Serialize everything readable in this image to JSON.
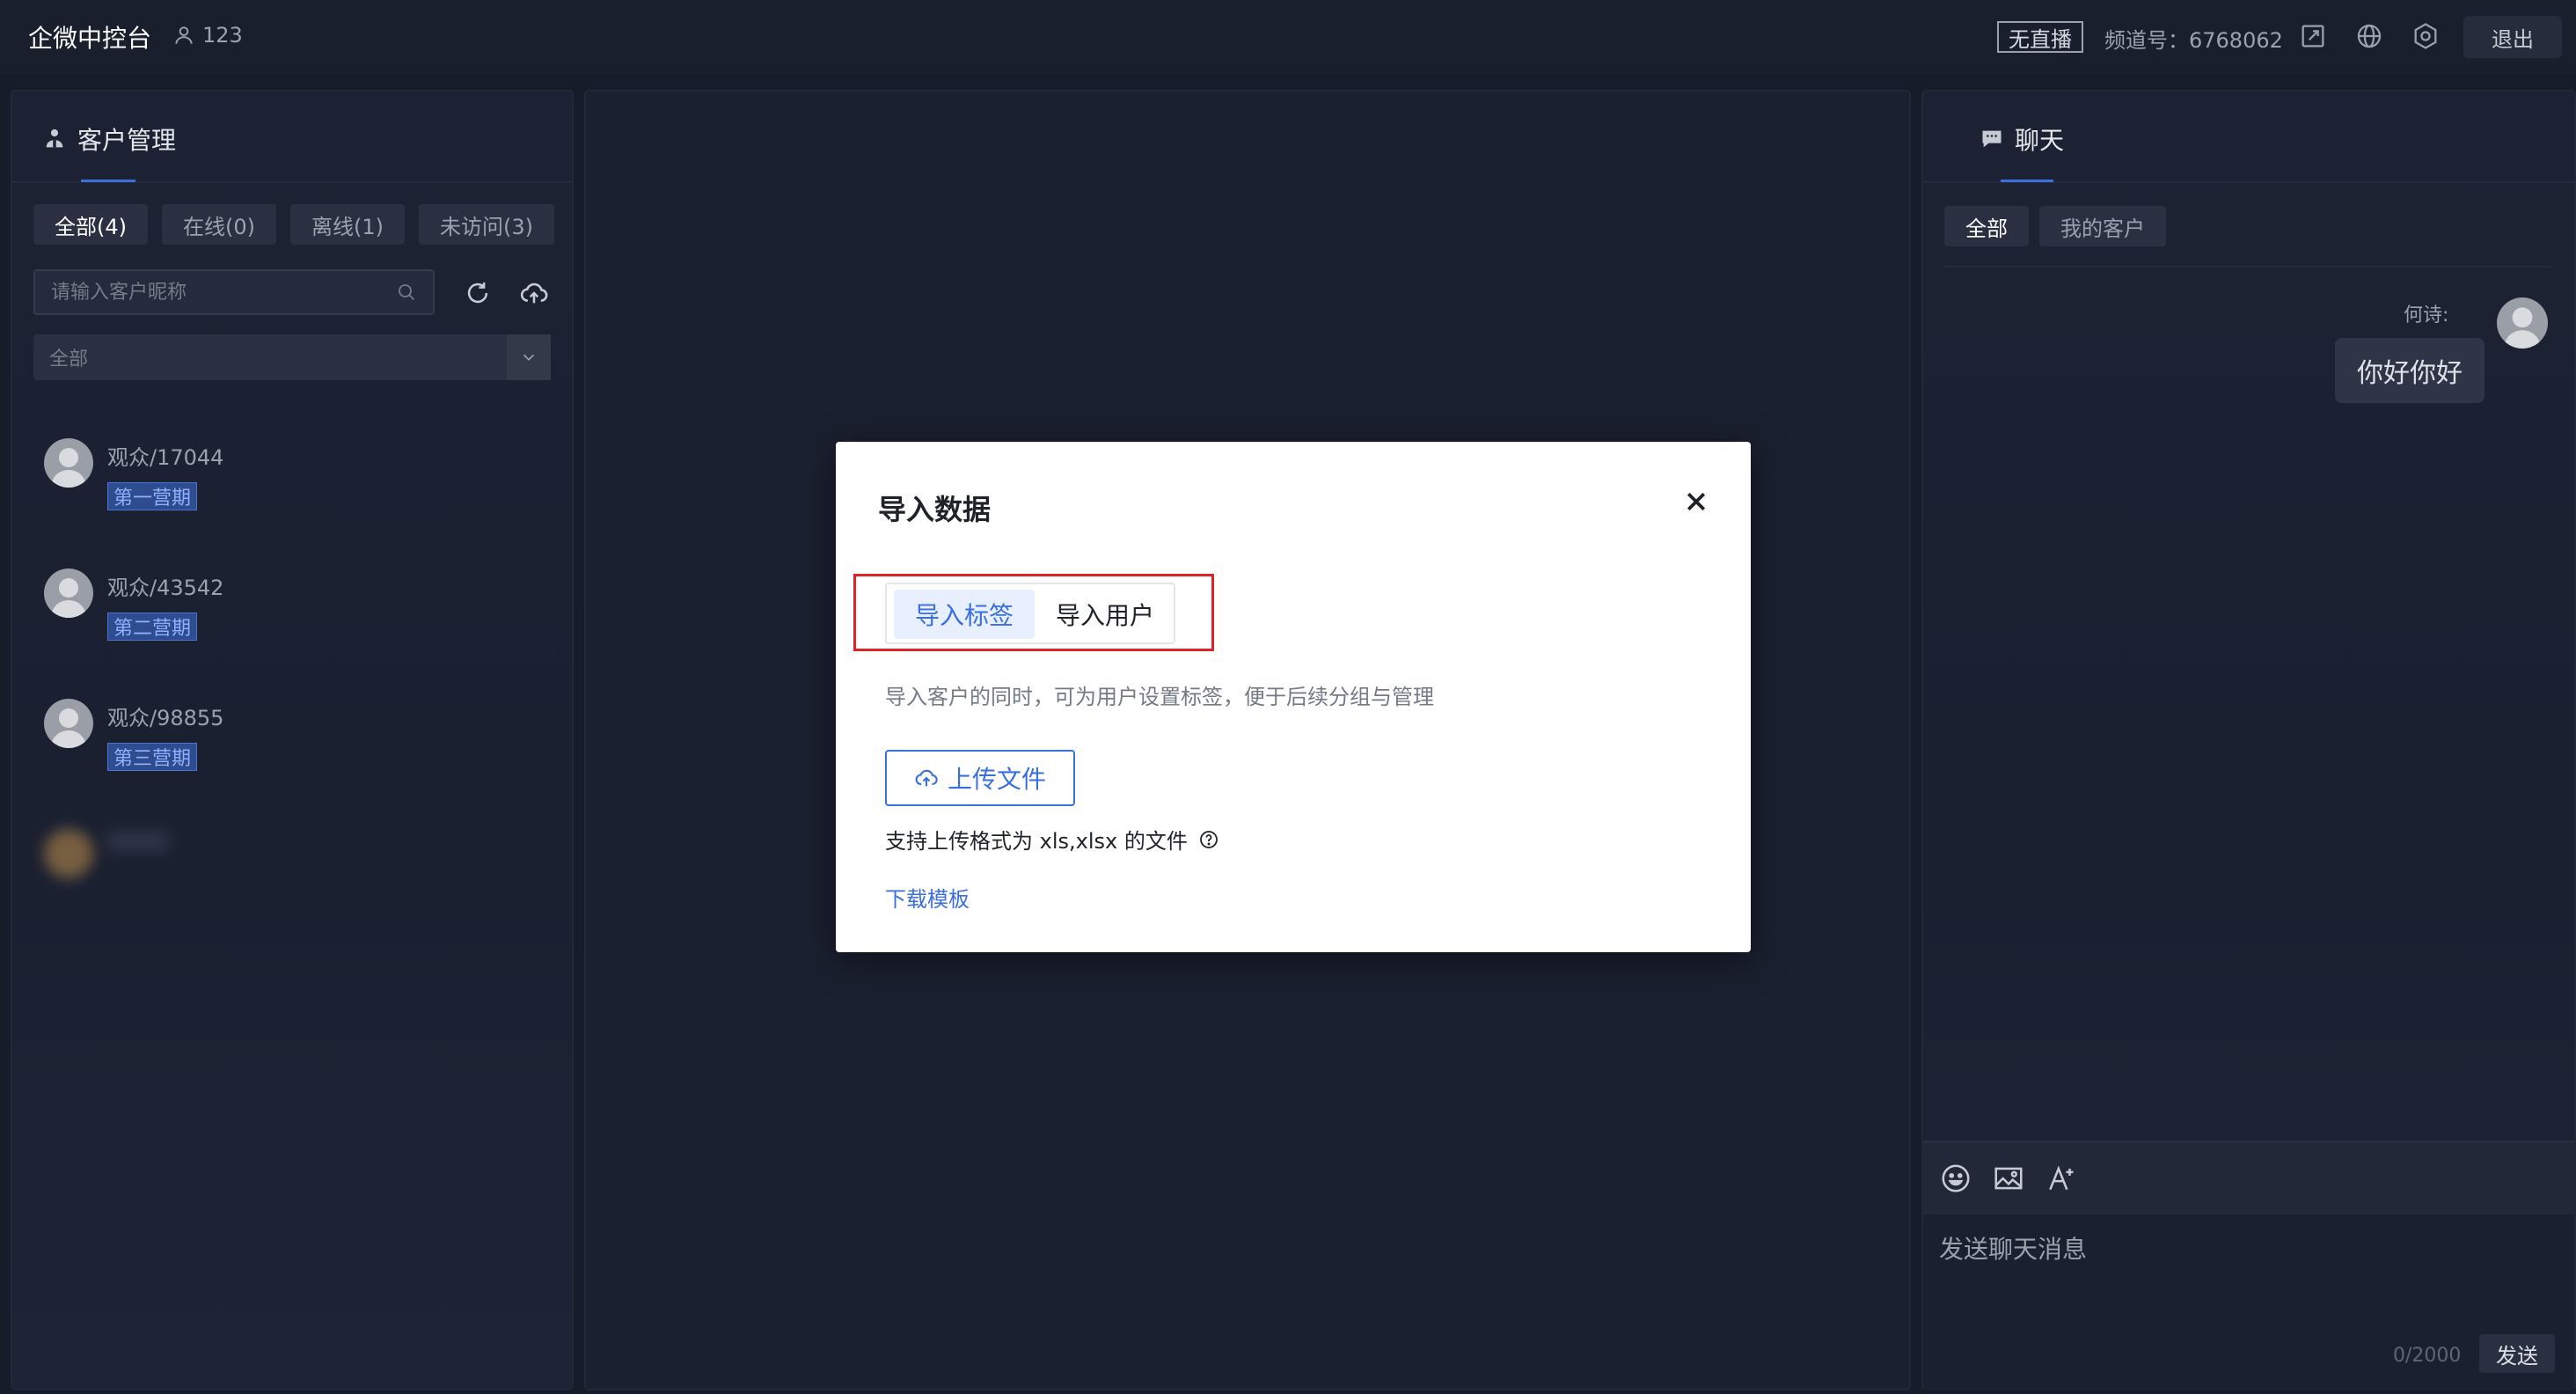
{
  "topbar": {
    "app_title": "企微中控台",
    "user_count": "123",
    "live_status": "无直播",
    "channel": "频道号：6768062",
    "logout_label": "退出"
  },
  "customers_panel": {
    "title": "客户管理",
    "filters": [
      "全部(4)",
      "在线(0)",
      "离线(1)",
      "未访问(3)"
    ],
    "active_filter": "全部(4)",
    "search_placeholder": "请输入客户昵称",
    "tag_select_value": "全部",
    "customers": [
      {
        "name": "观众/17044",
        "tag": "第一营期"
      },
      {
        "name": "观众/43542",
        "tag": "第二营期"
      },
      {
        "name": "观众/98855",
        "tag": "第三营期"
      }
    ]
  },
  "chat_panel": {
    "title": "聊天",
    "tabs": [
      "全部",
      "我的客户"
    ],
    "message": {
      "sender": "何诗:",
      "text": "你好你好"
    },
    "input_placeholder": "发送聊天消息",
    "char_count": "0/2000",
    "send_label": "发送"
  },
  "modal": {
    "title": "导入数据",
    "tabs": [
      "导入标签",
      "导入用户"
    ],
    "active_tab": "导入标签",
    "description": "导入客户的同时，可为用户设置标签，便于后续分组与管理",
    "upload_label": "上传文件",
    "support_text": "支持上传格式为 xls,xlsx 的文件",
    "download_label": "下载模板"
  },
  "colors": {
    "accent": "#3a6fe0",
    "highlight": "#e0222b",
    "background": "#171c2b",
    "tag_bg": "#2f4c8e"
  }
}
